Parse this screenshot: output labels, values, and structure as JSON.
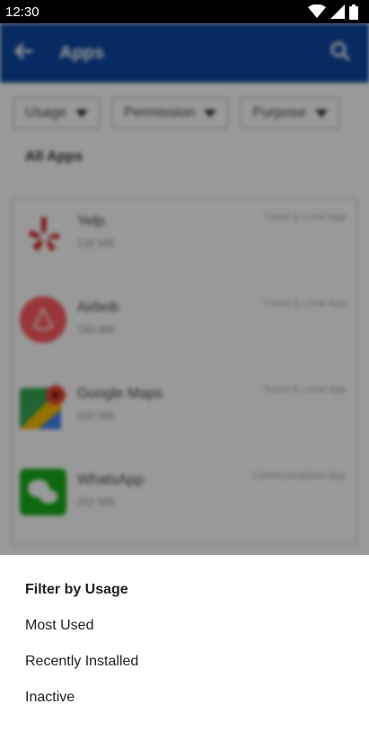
{
  "status_bar": {
    "time": "12:30"
  },
  "app_bar": {
    "title": "Apps"
  },
  "filters": [
    "Usage",
    "Permission",
    "Purpose"
  ],
  "section_title": "All Apps",
  "apps": [
    {
      "name": "Yelp",
      "size": "132 MB",
      "category": "Travel & Local App",
      "icon": "yelp-icon",
      "color": "#d32323"
    },
    {
      "name": "Airbnb",
      "size": "160 MB",
      "category": "Travel & Local App",
      "icon": "airbnb-icon",
      "color": "#ff5a5f"
    },
    {
      "name": "Google Maps",
      "size": "200 MB",
      "category": "Travel & Local App",
      "icon": "google-maps-icon",
      "color": "#34a853"
    },
    {
      "name": "WhatsApp",
      "size": "252 MB",
      "category": "Communications App",
      "icon": "wechat-icon",
      "color": "#1aad19"
    }
  ],
  "sheet": {
    "title": "Filter by Usage",
    "options": [
      "Most Used",
      "Recently Installed",
      "Inactive"
    ]
  }
}
